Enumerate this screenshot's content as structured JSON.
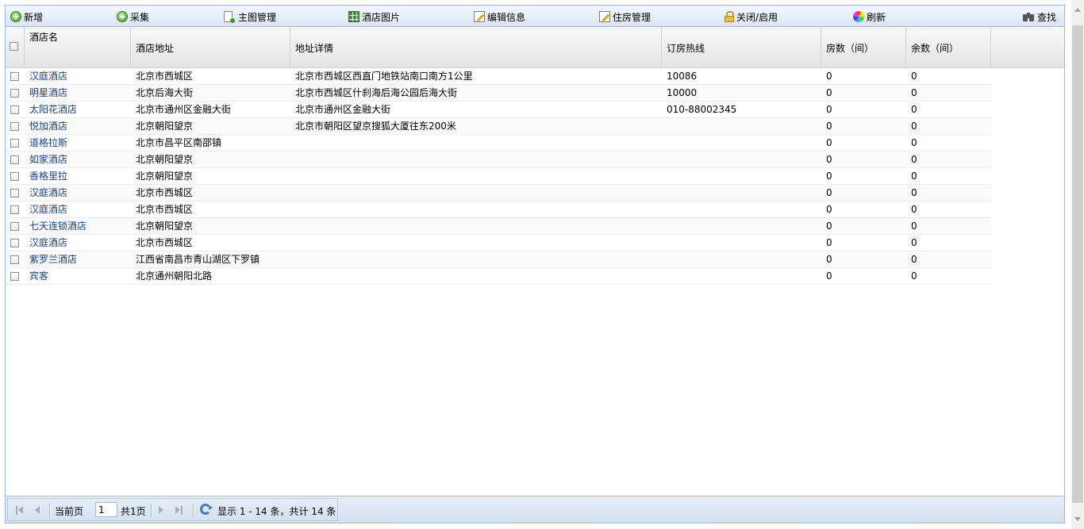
{
  "toolbar": {
    "add": {
      "label": "新增",
      "icon": "add-icon"
    },
    "collect": {
      "label": "采集",
      "icon": "add-icon"
    },
    "main_image": {
      "label": "主图管理",
      "icon": "document-add-icon"
    },
    "hotel_images": {
      "label": "酒店图片",
      "icon": "image-grid-icon"
    },
    "edit_info": {
      "label": "编辑信息",
      "icon": "edit-icon"
    },
    "room_manage": {
      "label": "住房管理",
      "icon": "edit-icon"
    },
    "toggle": {
      "label": "关闭/启用",
      "icon": "lock-icon"
    },
    "refresh": {
      "label": "刷新",
      "icon": "color-wheel-icon"
    },
    "search": {
      "label": "查找",
      "icon": "binoculars-icon"
    }
  },
  "columns": {
    "name": "酒店名",
    "address": "酒店地址",
    "detail": "地址详情",
    "hotline": "订房热线",
    "rooms": "房数（间）",
    "remaining": "余数（间）"
  },
  "rows": [
    {
      "name": "汉庭酒店",
      "address": "北京市西城区",
      "detail": "北京市西城区西直门地铁站南口南方1公里",
      "hotline": "10086",
      "rooms": "0",
      "remaining": "0"
    },
    {
      "name": "明星酒店",
      "address": "北京后海大街",
      "detail": "北京市西城区什刹海后海公园后海大街",
      "hotline": "10000",
      "rooms": "0",
      "remaining": "0"
    },
    {
      "name": "太阳花酒店",
      "address": "北京市通州区金融大街",
      "detail": "北京市通州区金融大街",
      "hotline": "010-88002345",
      "rooms": "0",
      "remaining": "0"
    },
    {
      "name": "悦加酒店",
      "address": "北京朝阳望京",
      "detail": "北京市朝阳区望京搜狐大厦往东200米",
      "hotline": "",
      "rooms": "0",
      "remaining": "0"
    },
    {
      "name": "道格拉斯",
      "address": "北京市昌平区南邵镇",
      "detail": "",
      "hotline": "",
      "rooms": "0",
      "remaining": "0"
    },
    {
      "name": "如家酒店",
      "address": "北京朝阳望京",
      "detail": "",
      "hotline": "",
      "rooms": "0",
      "remaining": "0"
    },
    {
      "name": "香格里拉",
      "address": "北京朝阳望京",
      "detail": "",
      "hotline": "",
      "rooms": "0",
      "remaining": "0"
    },
    {
      "name": "汉庭酒店",
      "address": "北京市西城区",
      "detail": "",
      "hotline": "",
      "rooms": "0",
      "remaining": "0"
    },
    {
      "name": "汉庭酒店",
      "address": "北京市西城区",
      "detail": "",
      "hotline": "",
      "rooms": "0",
      "remaining": "0"
    },
    {
      "name": "七天连锁酒店",
      "address": "北京朝阳望京",
      "detail": "",
      "hotline": "",
      "rooms": "0",
      "remaining": "0"
    },
    {
      "name": "汉庭酒店",
      "address": "北京市西城区",
      "detail": "",
      "hotline": "",
      "rooms": "0",
      "remaining": "0"
    },
    {
      "name": "紫罗兰酒店",
      "address": "江西省南昌市青山湖区下罗镇",
      "detail": "",
      "hotline": "",
      "rooms": "0",
      "remaining": "0"
    },
    {
      "name": "宾客",
      "address": "北京通州朝阳北路",
      "detail": "",
      "hotline": "",
      "rooms": "0",
      "remaining": "0"
    }
  ],
  "paging": {
    "current_label": "当前页",
    "current_page": "1",
    "total_pages_label": "共1页",
    "summary": "显示 1 - 14 条，共计 14 条"
  },
  "colors": {
    "link": "#15428b",
    "border": "#99bbe8"
  }
}
